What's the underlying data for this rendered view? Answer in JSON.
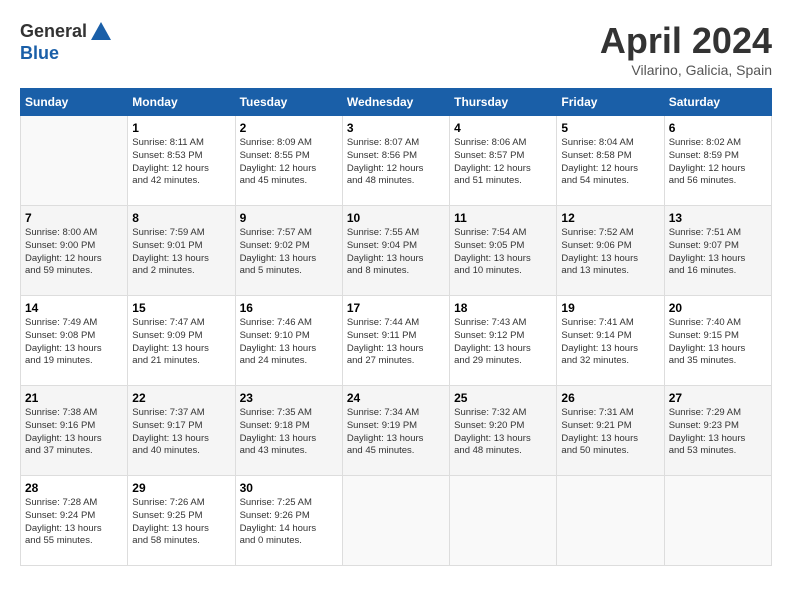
{
  "header": {
    "logo_general": "General",
    "logo_blue": "Blue",
    "month_title": "April 2024",
    "location": "Vilarino, Galicia, Spain"
  },
  "columns": [
    "Sunday",
    "Monday",
    "Tuesday",
    "Wednesday",
    "Thursday",
    "Friday",
    "Saturday"
  ],
  "weeks": [
    [
      {
        "day": "",
        "info": ""
      },
      {
        "day": "1",
        "info": "Sunrise: 8:11 AM\nSunset: 8:53 PM\nDaylight: 12 hours\nand 42 minutes."
      },
      {
        "day": "2",
        "info": "Sunrise: 8:09 AM\nSunset: 8:55 PM\nDaylight: 12 hours\nand 45 minutes."
      },
      {
        "day": "3",
        "info": "Sunrise: 8:07 AM\nSunset: 8:56 PM\nDaylight: 12 hours\nand 48 minutes."
      },
      {
        "day": "4",
        "info": "Sunrise: 8:06 AM\nSunset: 8:57 PM\nDaylight: 12 hours\nand 51 minutes."
      },
      {
        "day": "5",
        "info": "Sunrise: 8:04 AM\nSunset: 8:58 PM\nDaylight: 12 hours\nand 54 minutes."
      },
      {
        "day": "6",
        "info": "Sunrise: 8:02 AM\nSunset: 8:59 PM\nDaylight: 12 hours\nand 56 minutes."
      }
    ],
    [
      {
        "day": "7",
        "info": "Sunrise: 8:00 AM\nSunset: 9:00 PM\nDaylight: 12 hours\nand 59 minutes."
      },
      {
        "day": "8",
        "info": "Sunrise: 7:59 AM\nSunset: 9:01 PM\nDaylight: 13 hours\nand 2 minutes."
      },
      {
        "day": "9",
        "info": "Sunrise: 7:57 AM\nSunset: 9:02 PM\nDaylight: 13 hours\nand 5 minutes."
      },
      {
        "day": "10",
        "info": "Sunrise: 7:55 AM\nSunset: 9:04 PM\nDaylight: 13 hours\nand 8 minutes."
      },
      {
        "day": "11",
        "info": "Sunrise: 7:54 AM\nSunset: 9:05 PM\nDaylight: 13 hours\nand 10 minutes."
      },
      {
        "day": "12",
        "info": "Sunrise: 7:52 AM\nSunset: 9:06 PM\nDaylight: 13 hours\nand 13 minutes."
      },
      {
        "day": "13",
        "info": "Sunrise: 7:51 AM\nSunset: 9:07 PM\nDaylight: 13 hours\nand 16 minutes."
      }
    ],
    [
      {
        "day": "14",
        "info": "Sunrise: 7:49 AM\nSunset: 9:08 PM\nDaylight: 13 hours\nand 19 minutes."
      },
      {
        "day": "15",
        "info": "Sunrise: 7:47 AM\nSunset: 9:09 PM\nDaylight: 13 hours\nand 21 minutes."
      },
      {
        "day": "16",
        "info": "Sunrise: 7:46 AM\nSunset: 9:10 PM\nDaylight: 13 hours\nand 24 minutes."
      },
      {
        "day": "17",
        "info": "Sunrise: 7:44 AM\nSunset: 9:11 PM\nDaylight: 13 hours\nand 27 minutes."
      },
      {
        "day": "18",
        "info": "Sunrise: 7:43 AM\nSunset: 9:12 PM\nDaylight: 13 hours\nand 29 minutes."
      },
      {
        "day": "19",
        "info": "Sunrise: 7:41 AM\nSunset: 9:14 PM\nDaylight: 13 hours\nand 32 minutes."
      },
      {
        "day": "20",
        "info": "Sunrise: 7:40 AM\nSunset: 9:15 PM\nDaylight: 13 hours\nand 35 minutes."
      }
    ],
    [
      {
        "day": "21",
        "info": "Sunrise: 7:38 AM\nSunset: 9:16 PM\nDaylight: 13 hours\nand 37 minutes."
      },
      {
        "day": "22",
        "info": "Sunrise: 7:37 AM\nSunset: 9:17 PM\nDaylight: 13 hours\nand 40 minutes."
      },
      {
        "day": "23",
        "info": "Sunrise: 7:35 AM\nSunset: 9:18 PM\nDaylight: 13 hours\nand 43 minutes."
      },
      {
        "day": "24",
        "info": "Sunrise: 7:34 AM\nSunset: 9:19 PM\nDaylight: 13 hours\nand 45 minutes."
      },
      {
        "day": "25",
        "info": "Sunrise: 7:32 AM\nSunset: 9:20 PM\nDaylight: 13 hours\nand 48 minutes."
      },
      {
        "day": "26",
        "info": "Sunrise: 7:31 AM\nSunset: 9:21 PM\nDaylight: 13 hours\nand 50 minutes."
      },
      {
        "day": "27",
        "info": "Sunrise: 7:29 AM\nSunset: 9:23 PM\nDaylight: 13 hours\nand 53 minutes."
      }
    ],
    [
      {
        "day": "28",
        "info": "Sunrise: 7:28 AM\nSunset: 9:24 PM\nDaylight: 13 hours\nand 55 minutes."
      },
      {
        "day": "29",
        "info": "Sunrise: 7:26 AM\nSunset: 9:25 PM\nDaylight: 13 hours\nand 58 minutes."
      },
      {
        "day": "30",
        "info": "Sunrise: 7:25 AM\nSunset: 9:26 PM\nDaylight: 14 hours\nand 0 minutes."
      },
      {
        "day": "",
        "info": ""
      },
      {
        "day": "",
        "info": ""
      },
      {
        "day": "",
        "info": ""
      },
      {
        "day": "",
        "info": ""
      }
    ]
  ]
}
